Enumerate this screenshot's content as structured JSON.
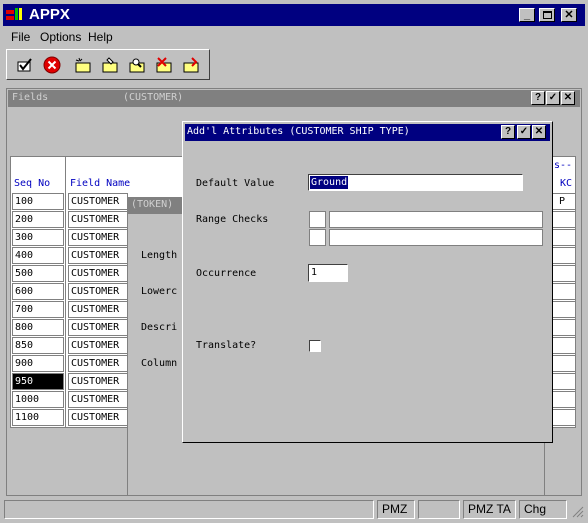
{
  "app": {
    "title": "APPX"
  },
  "menu": {
    "file": "File",
    "options": "Options",
    "help": "Help"
  },
  "fields_window": {
    "title": "Fields",
    "subtitle": "(CUSTOMER)"
  },
  "columns": {
    "seq": "Seq No",
    "field": "Field Name",
    "s_header": "s--",
    "kc": "KC"
  },
  "rows": [
    {
      "seq": "100",
      "field": "CUSTOMER",
      "kc": "P"
    },
    {
      "seq": "200",
      "field": "CUSTOMER",
      "kc": ""
    },
    {
      "seq": "300",
      "field": "CUSTOMER",
      "kc": ""
    },
    {
      "seq": "400",
      "field": "CUSTOMER",
      "kc": ""
    },
    {
      "seq": "500",
      "field": "CUSTOMER",
      "kc": ""
    },
    {
      "seq": "600",
      "field": "CUSTOMER",
      "kc": ""
    },
    {
      "seq": "700",
      "field": "CUSTOMER",
      "kc": ""
    },
    {
      "seq": "800",
      "field": "CUSTOMER",
      "kc": ""
    },
    {
      "seq": "850",
      "field": "CUSTOMER",
      "kc": ""
    },
    {
      "seq": "900",
      "field": "CUSTOMER",
      "kc": ""
    },
    {
      "seq": "950",
      "field": "CUSTOMER",
      "kc": ""
    },
    {
      "seq": "1000",
      "field": "CUSTOMER",
      "kc": ""
    },
    {
      "seq": "1100",
      "field": "CUSTOMER",
      "kc": ""
    }
  ],
  "token_window": {
    "title": "(TOKEN)",
    "labels": {
      "length": "Length",
      "lowercase": "Lowerc",
      "description": "Descri",
      "column": "Column"
    }
  },
  "dialog": {
    "title": "Add'l Attributes (CUSTOMER SHIP TYPE)",
    "default_value_label": "Default Value",
    "default_value": "Ground",
    "range_checks_label": "Range Checks",
    "occurrence_label": "Occurrence",
    "occurrence_value": "1",
    "translate_label": "Translate?"
  },
  "status": {
    "pane1": "PMZ",
    "pane2": "PMZ TA",
    "pane3": "Chg"
  },
  "icons": [
    "check-icon",
    "cancel-icon",
    "add-record-icon",
    "edit-record-icon",
    "search-record-icon",
    "delete-record-icon",
    "end-icon"
  ]
}
